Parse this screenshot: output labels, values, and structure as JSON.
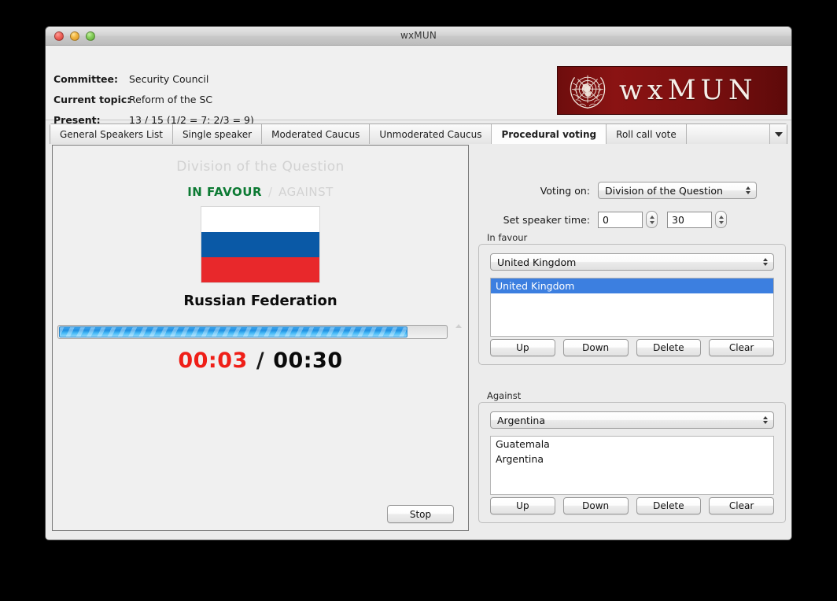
{
  "window": {
    "title": "wxMUN",
    "controls": [
      "close",
      "minimize",
      "zoom"
    ]
  },
  "header": {
    "committee_label": "Committee:",
    "committee_value": "Security Council",
    "topic_label": "Current topic:",
    "topic_value": "Reform of the SC",
    "present_label": "Present:",
    "present_value": "13 / 15  (1/2 = 7; 2/3 = 9)",
    "logo_text": "wxMUN",
    "logo_bg": "#7d1010"
  },
  "tabs": {
    "items": [
      {
        "label": "General Speakers List",
        "active": false
      },
      {
        "label": "Single speaker",
        "active": false
      },
      {
        "label": "Moderated Caucus",
        "active": false
      },
      {
        "label": "Unmoderated Caucus",
        "active": false
      },
      {
        "label": "Procedural voting",
        "active": true
      },
      {
        "label": "Roll call vote",
        "active": false
      }
    ],
    "overflow_icon": "chevron-down-icon"
  },
  "left_panel": {
    "question": "Division of the Question",
    "stance_favour": "IN FAVOUR",
    "stance_separator": "/",
    "stance_against": "AGAINST",
    "favour_color": "#0c7a33",
    "inactive_color": "#d2d2d2",
    "speaker_country": "Russian Federation",
    "flag_bands": [
      "#ffffff",
      "#0a59a6",
      "#e8282b"
    ],
    "progress_percent": 90,
    "timer_elapsed": "00:03",
    "timer_separator": "/",
    "timer_total": "00:30",
    "timer_elapsed_color": "#ef1f18",
    "stop_label": "Stop"
  },
  "right_panel": {
    "voting_on_label": "Voting on:",
    "voting_on_value": "Division of the Question",
    "speaker_time_label": "Set speaker time:",
    "speaker_time_minutes": "0",
    "speaker_time_seconds": "30",
    "in_favour": {
      "title": "In favour",
      "combo_value": "United Kingdom",
      "list": [
        {
          "label": "United Kingdom",
          "selected": true
        }
      ],
      "buttons": [
        "Up",
        "Down",
        "Delete",
        "Clear"
      ]
    },
    "against": {
      "title": "Against",
      "combo_value": "Argentina",
      "list": [
        {
          "label": "Guatemala",
          "selected": false
        },
        {
          "label": "Argentina",
          "selected": false
        }
      ],
      "buttons": [
        "Up",
        "Down",
        "Delete",
        "Clear"
      ]
    }
  }
}
